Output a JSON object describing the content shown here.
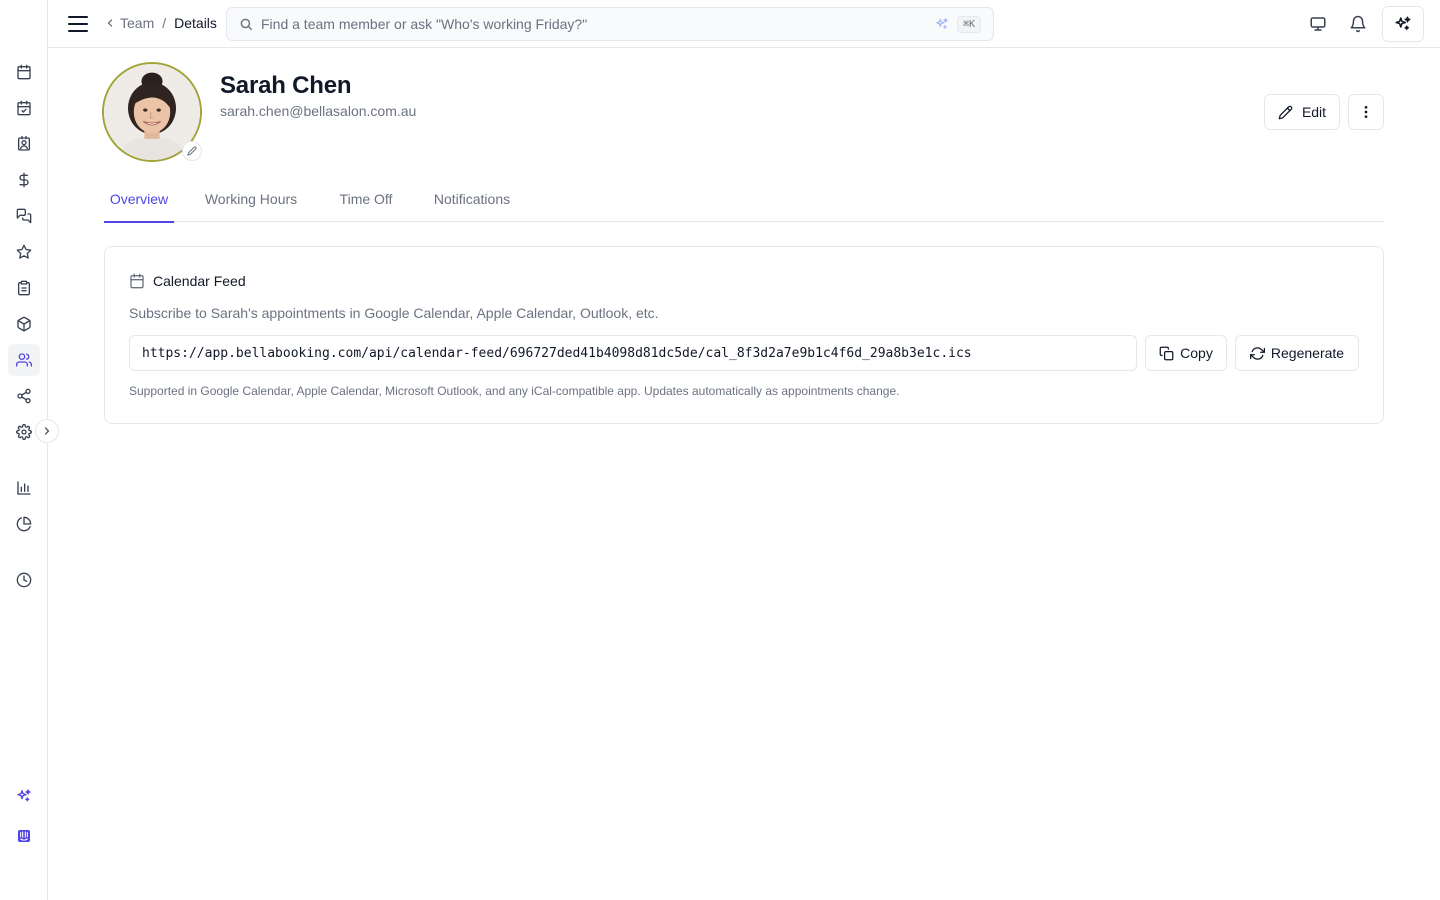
{
  "sidebar": {
    "items": [
      {
        "icon": "calendar-icon"
      },
      {
        "icon": "calendar-check-icon"
      },
      {
        "icon": "contact-card-icon"
      },
      {
        "icon": "dollar-icon"
      },
      {
        "icon": "messages-icon"
      },
      {
        "icon": "star-icon"
      },
      {
        "icon": "clipboard-icon"
      },
      {
        "icon": "package-icon"
      },
      {
        "icon": "users-icon",
        "active": true
      },
      {
        "icon": "share-icon"
      },
      {
        "icon": "settings-icon"
      },
      {
        "icon": "bar-chart-icon"
      },
      {
        "icon": "pie-chart-icon"
      },
      {
        "icon": "clock-icon"
      },
      {
        "icon": "sparkles-icon"
      },
      {
        "icon": "intercom-icon"
      }
    ],
    "accent": "#4f46e5"
  },
  "header": {
    "breadcrumb_parent": "Team",
    "breadcrumb_separator": "/",
    "breadcrumb_current": "Details",
    "search_placeholder": "Find a team member or ask \"Who's working Friday?\"",
    "search_shortcut": "⌘K"
  },
  "profile": {
    "name": "Sarah Chen",
    "email": "sarah.chen@bellasalon.com.au",
    "edit_label": "Edit"
  },
  "tabs": [
    {
      "label": "Overview",
      "active": true
    },
    {
      "label": "Working Hours",
      "active": false
    },
    {
      "label": "Time Off",
      "active": false
    },
    {
      "label": "Notifications",
      "active": false
    }
  ],
  "calendar_feed": {
    "title": "Calendar Feed",
    "description": "Subscribe to Sarah's appointments in Google Calendar, Apple Calendar, Outlook, etc.",
    "url": "https://app.bellabooking.com/api/calendar-feed/696727ded41b4098d81dc5de/cal_8f3d2a7e9b1c4f6d_29a8b3e1c.ics",
    "copy_label": "Copy",
    "regenerate_label": "Regenerate",
    "note": "Supported in Google Calendar, Apple Calendar, Microsoft Outlook, and any iCal-compatible app. Updates automatically as appointments change."
  }
}
